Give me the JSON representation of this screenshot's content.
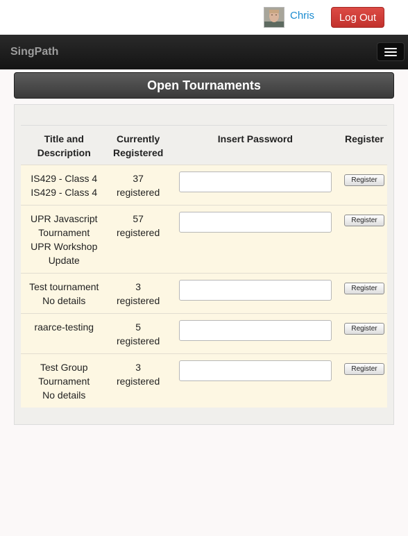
{
  "user": {
    "name": "Chris",
    "logout_label": "Log Out"
  },
  "navbar": {
    "brand": "SingPath"
  },
  "page": {
    "title": "Open Tournaments"
  },
  "table": {
    "headers": {
      "title": [
        "Title and",
        "Description"
      ],
      "registered": [
        "Currently",
        "Registered"
      ],
      "password": "Insert Password",
      "register": "Register"
    },
    "rows": [
      {
        "title": [
          "IS429 - Class 4",
          "IS429 - Class 4"
        ],
        "count": "37",
        "count_label": "registered",
        "password": "",
        "button": "Register"
      },
      {
        "title": [
          "UPR Javascript",
          "Tournament",
          "UPR Workshop",
          "Update"
        ],
        "count": "57",
        "count_label": "registered",
        "password": "",
        "button": "Register"
      },
      {
        "title": [
          "Test tournament",
          "No details"
        ],
        "count": "3",
        "count_label": "registered",
        "password": "",
        "button": "Register"
      },
      {
        "title": [
          "raarce-testing"
        ],
        "count": "5",
        "count_label": "registered",
        "password": "",
        "button": "Register"
      },
      {
        "title": [
          "Test Group",
          "Tournament",
          "No details"
        ],
        "count": "3",
        "count_label": "registered",
        "password": "",
        "button": "Register"
      }
    ]
  },
  "colors": {
    "accent_link": "#1a8bd0",
    "logout": "#d03f3a",
    "row_bg": "#fdf7e3"
  },
  "icons": {
    "avatar": "user-avatar",
    "menu": "hamburger-menu-icon"
  }
}
